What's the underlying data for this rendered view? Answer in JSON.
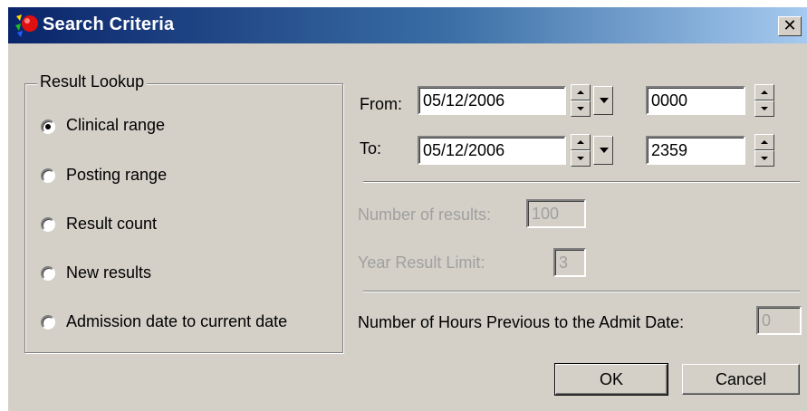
{
  "window": {
    "title": "Search Criteria",
    "close_glyph": "✕"
  },
  "result_lookup": {
    "label": "Result Lookup",
    "options": [
      {
        "label": "Clinical range",
        "selected": true
      },
      {
        "label": "Posting range",
        "selected": false
      },
      {
        "label": "Result count",
        "selected": false
      },
      {
        "label": "New results",
        "selected": false
      },
      {
        "label": "Admission date to current date",
        "selected": false
      }
    ]
  },
  "date_range": {
    "from_label": "From:",
    "from_date": "05/12/2006",
    "from_time": "0000",
    "to_label": "To:",
    "to_date": "05/12/2006",
    "to_time": "2359"
  },
  "number_of_results": {
    "label": "Number of results:",
    "value": "100",
    "enabled": false
  },
  "year_result_limit": {
    "label": "Year Result Limit:",
    "value": "3",
    "enabled": false
  },
  "hours_previous": {
    "label": "Number of Hours Previous to the Admit Date:",
    "value": "0",
    "enabled": false
  },
  "buttons": {
    "ok": "OK",
    "cancel": "Cancel"
  },
  "icons": {
    "app": "app-logo-icon",
    "spin": "spinner-icon",
    "dropdown": "calendar-dropdown-icon"
  },
  "colors": {
    "face": "#d4d0c8",
    "title_start": "#0a246a",
    "title_end": "#a6caf0",
    "disabled_text": "#a0a0a0"
  }
}
